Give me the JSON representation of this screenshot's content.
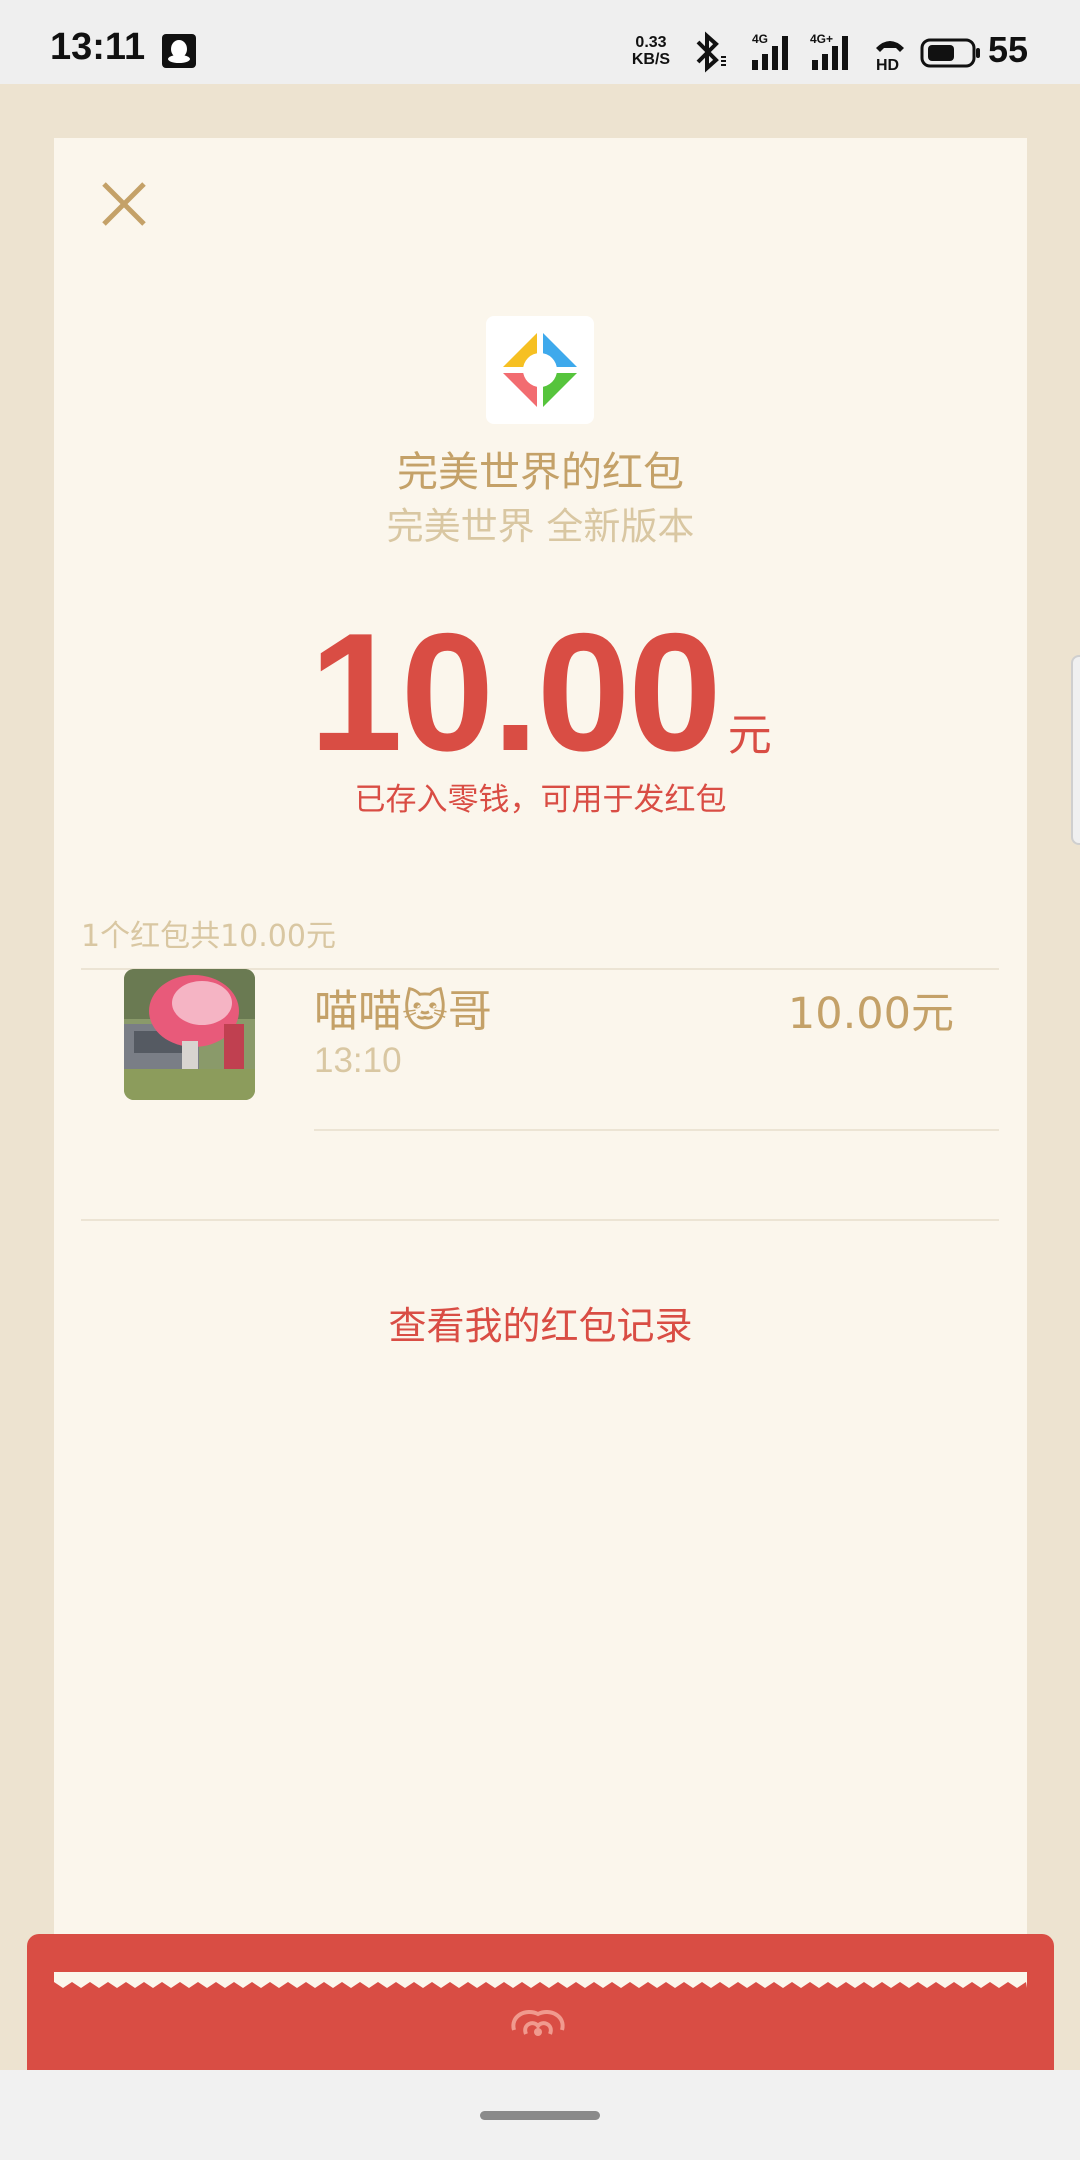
{
  "status_bar": {
    "time": "13:11",
    "net_speed_value": "0.33",
    "net_speed_unit": "KB/S",
    "signal_1_label": "4G",
    "signal_2_label": "4G+",
    "hd_label": "HD",
    "battery_level": "55"
  },
  "card": {
    "sender_title": "完美世界的红包",
    "sender_subtitle": "完美世界 全新版本",
    "amount": "10.00",
    "amount_unit": "元",
    "amount_note": "已存入零钱，可用于发红包",
    "summary": "1个红包共10.00元",
    "record": {
      "name": "喵喵🐱哥",
      "time": "13:10",
      "amount": "10.00元"
    },
    "history_link": "查看我的红包记录"
  },
  "colors": {
    "accent_red": "#d94d44",
    "gold": "#c4a168",
    "light_gold": "#d9c7a2",
    "card_bg": "#fbf6ec",
    "page_bg": "#ede3d0"
  },
  "icons": [
    "qq-icon",
    "bluetooth-icon",
    "signal-icon",
    "hd-call-icon",
    "battery-icon",
    "close-icon",
    "app-logo-icon",
    "cloud-emblem-icon"
  ]
}
